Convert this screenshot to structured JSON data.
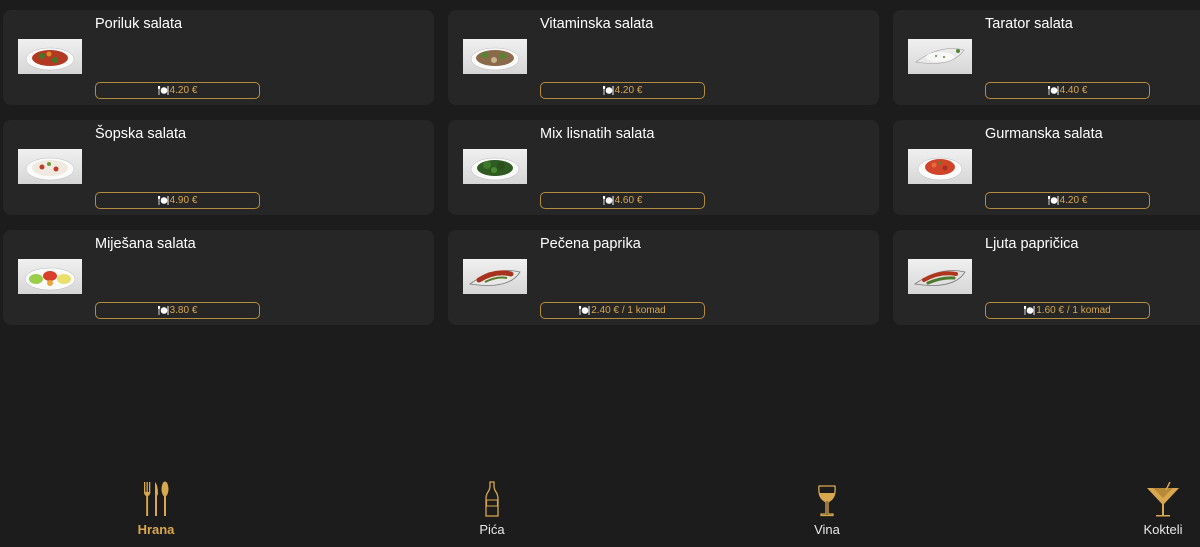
{
  "colors": {
    "accent": "#d9a84e",
    "card": "#262626",
    "background": "#1c1c1c"
  },
  "menu_items": [
    {
      "name": "Poriluk salata",
      "price": "4.20 €",
      "image": "mixed-salad-image"
    },
    {
      "name": "Vitaminska salata",
      "price": "4.20 €",
      "image": "vitamin-salad-image"
    },
    {
      "name": "Tarator salata",
      "price": "4.40 €",
      "image": "tarator-image"
    },
    {
      "name": "Šopska salata",
      "price": "4.90 €",
      "image": "sopska-salad-image"
    },
    {
      "name": "Mix lisnatih salata",
      "price": "4.60 €",
      "image": "leaf-salad-image"
    },
    {
      "name": "Gurmanska salata",
      "price": "4.20 €",
      "image": "gourmet-salad-image"
    },
    {
      "name": "Miješana salata",
      "price": "3.80 €",
      "image": "mixed-platter-image"
    },
    {
      "name": "Pečena paprika",
      "price": "2.40 € / 1 komad",
      "image": "roasted-pepper-image"
    },
    {
      "name": "Ljuta papričica",
      "price": "1.60 € / 1 komad",
      "image": "hot-pepper-image"
    }
  ],
  "price_icon": "cutlery-plate-icon",
  "bottom_nav": {
    "items": [
      {
        "label": "Hrana",
        "icon": "fork-knife-icon",
        "active": true
      },
      {
        "label": "Pića",
        "icon": "bottle-icon",
        "active": false
      },
      {
        "label": "Vina",
        "icon": "wine-glass-icon",
        "active": false
      },
      {
        "label": "Kokteli",
        "icon": "cocktail-glass-icon",
        "active": false
      }
    ]
  }
}
